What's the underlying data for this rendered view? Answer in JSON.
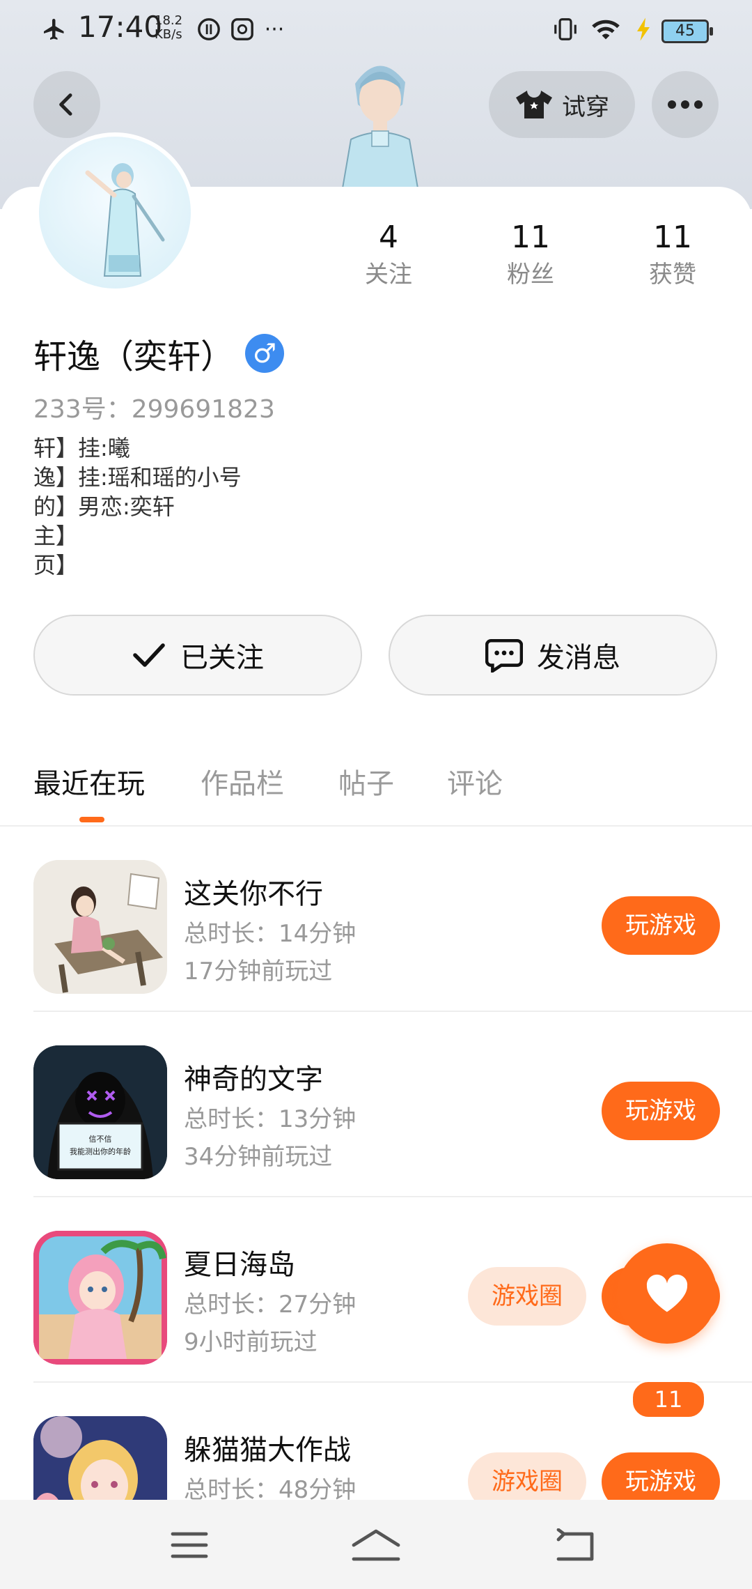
{
  "status_bar": {
    "time": "17:40",
    "speed_value": "18.2",
    "speed_unit": "KB/s",
    "battery": "45",
    "more": "···"
  },
  "header": {
    "tryon_label": "试穿"
  },
  "profile": {
    "stats": [
      {
        "value": "4",
        "label": "关注"
      },
      {
        "value": "11",
        "label": "粉丝"
      },
      {
        "value": "11",
        "label": "获赞"
      }
    ],
    "name": "轩逸（奕轩）",
    "gender_symbol": "♂",
    "id_text": "233号：299691823",
    "bio_lines": [
      "轩】挂:曦",
      "逸】挂:瑶和瑶的小号",
      "的】男恋:奕轩",
      "主】",
      "页】"
    ],
    "follow_button": "已关注",
    "message_button": "发消息"
  },
  "tabs": [
    "最近在玩",
    "作品栏",
    "帖子",
    "评论"
  ],
  "games": [
    {
      "name": "这关你不行",
      "duration": "总时长：14分钟",
      "last_played": "17分钟前玩过",
      "play_label": "玩游戏",
      "circle_label": null
    },
    {
      "name": "神奇的文字",
      "duration": "总时长：13分钟",
      "last_played": "34分钟前玩过",
      "play_label": "玩游戏",
      "circle_label": null
    },
    {
      "name": "夏日海岛",
      "duration": "总时长：27分钟",
      "last_played": "9小时前玩过",
      "play_label": "玩游戏",
      "circle_label": "游戏圈"
    },
    {
      "name": "躲猫猫大作战",
      "duration": "总时长：48分钟",
      "last_played": "",
      "play_label": "玩游戏",
      "circle_label": "游戏圈"
    }
  ],
  "game2_icon_text": [
    "信不信",
    "我能测出你的年龄"
  ],
  "like_fab": {
    "count": "11"
  },
  "colors": {
    "accent": "#ff6a1a",
    "gender_blue": "#3d8cf0"
  }
}
